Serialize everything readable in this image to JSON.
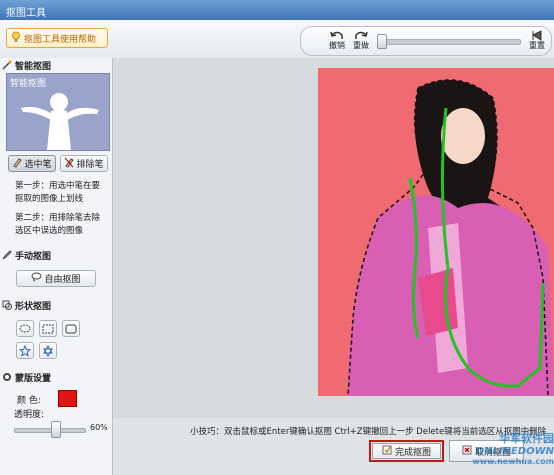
{
  "window": {
    "title": "抠图工具"
  },
  "toolbar": {
    "help_label": "抠图工具使用帮助",
    "undo_label": "撤销",
    "redo_label": "重做",
    "restore_label": "重置"
  },
  "left_panel": {
    "smart": {
      "title": "智能抠图",
      "preview_label": "智能抠图",
      "select_pen": "选中笔",
      "exclude_pen": "排除笔",
      "step1": "第一步：用选中笔在要抠取的图像上划线",
      "step2": "第二步：用排除笔去除选区中误选的图像"
    },
    "manual": {
      "title": "手动抠图",
      "free_button": "自由抠图"
    },
    "shape": {
      "title": "形状抠图",
      "shapes": [
        "ellipse-icon",
        "rect-icon",
        "rounded-rect-icon",
        "star-icon",
        "hexagram-icon"
      ]
    },
    "mask": {
      "title": "蒙版设置",
      "color_label": "颜  色:",
      "color_value": "#e11414",
      "opacity_label": "透明度:",
      "opacity_value": "60%"
    }
  },
  "bottom": {
    "tips": "小技巧：双击鼠标或Enter键确认抠图   Ctrl+Z键撤回上一步   Delete键将当前选区从抠图中删除",
    "finish_label": "完成抠图",
    "cancel_label": "取消抠图"
  },
  "watermark": {
    "line1": "华军软件园",
    "line2": "ONLINEDOWN",
    "line3": "www.newhua.com"
  },
  "colors": {
    "accent": "#3f74b8",
    "photo_bg": "#f06a72",
    "selection": "#22c322"
  }
}
